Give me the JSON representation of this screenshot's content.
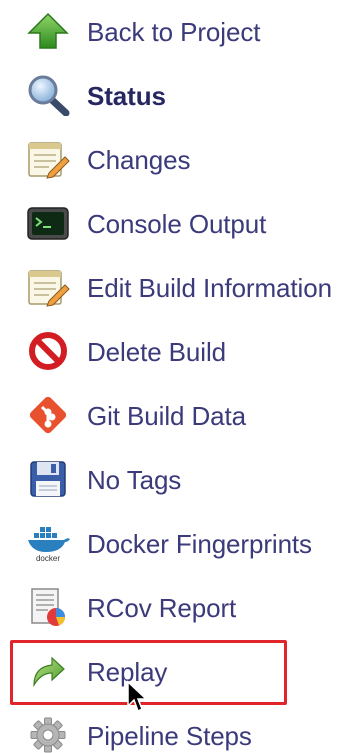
{
  "sidebar": {
    "items": [
      {
        "label": "Back to Project",
        "icon": "up-arrow-icon",
        "current": false
      },
      {
        "label": "Status",
        "icon": "magnifier-icon",
        "current": true
      },
      {
        "label": "Changes",
        "icon": "notepad-icon",
        "current": false
      },
      {
        "label": "Console Output",
        "icon": "terminal-icon",
        "current": false
      },
      {
        "label": "Edit Build Information",
        "icon": "notepad-icon",
        "current": false
      },
      {
        "label": "Delete Build",
        "icon": "no-entry-icon",
        "current": false
      },
      {
        "label": "Git Build Data",
        "icon": "git-icon",
        "current": false
      },
      {
        "label": "No Tags",
        "icon": "floppy-disk-icon",
        "current": false
      },
      {
        "label": "Docker Fingerprints",
        "icon": "docker-icon",
        "current": false
      },
      {
        "label": "RCov Report",
        "icon": "report-chart-icon",
        "current": false
      },
      {
        "label": "Replay",
        "icon": "replay-arrow-icon",
        "current": false,
        "highlighted": true
      },
      {
        "label": "Pipeline Steps",
        "icon": "gear-icon",
        "current": false
      }
    ]
  },
  "colors": {
    "link": "#3b3a7a",
    "highlight_border": "#e0262b"
  }
}
